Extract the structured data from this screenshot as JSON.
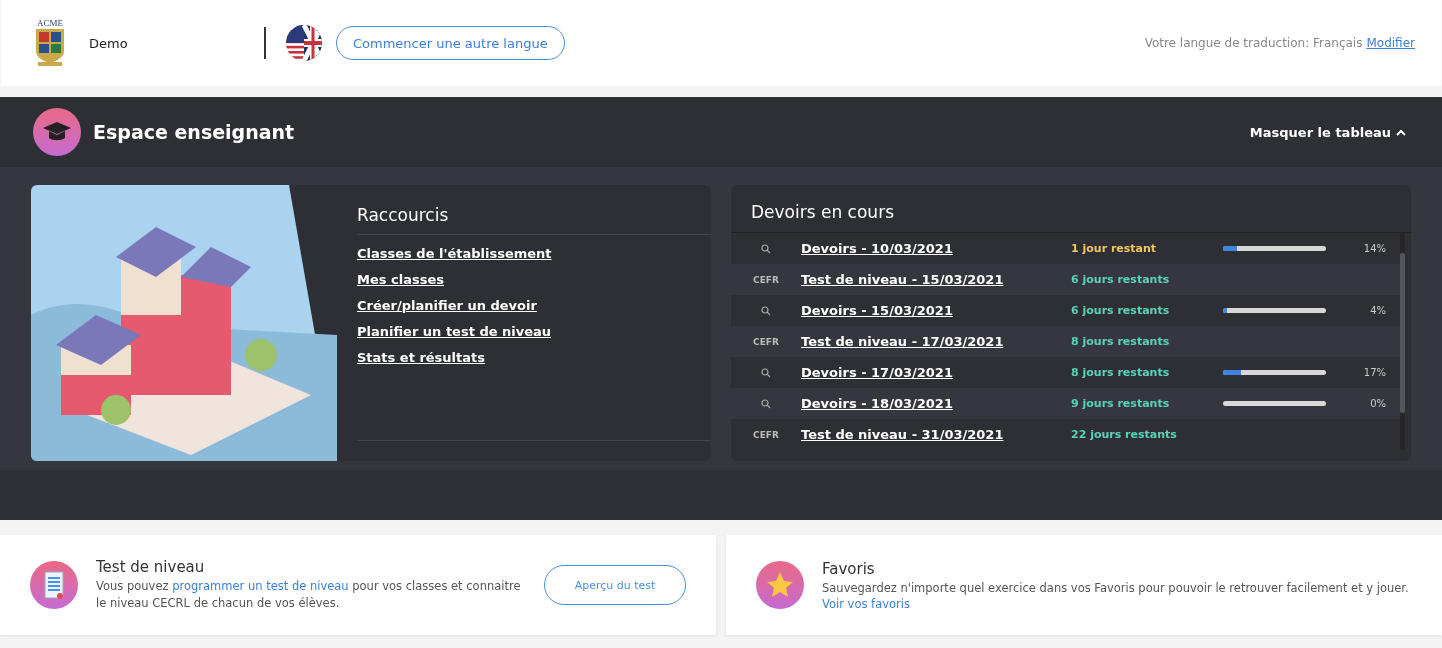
{
  "header": {
    "logo_text": "ACME",
    "user_name": "Demo",
    "language_button": "Commencer une autre langue",
    "translation_label": "Votre langue de traduction: Français",
    "translation_link": "Modifier"
  },
  "teacher_space": {
    "title": "Espace enseignant",
    "toggle": "Masquer le tableau",
    "expanded": true,
    "shortcuts": {
      "title": "Raccourcis",
      "links": [
        "Classes de l'établissement",
        "Mes classes",
        "Créer/planifier un devoir",
        "Planifier un test de niveau",
        "Stats et résultats"
      ]
    },
    "assignments": {
      "title": "Devoirs en cours",
      "rows": [
        {
          "kind": "homework",
          "title": "Devoirs - 10/03/2021",
          "remaining": "1 jour restant",
          "urgent": true,
          "level": 0.14,
          "percent": "14%"
        },
        {
          "kind": "test",
          "tag": "CEFR",
          "title": "Test de niveau - 15/03/2021",
          "remaining": "6 jours restants",
          "urgent": false
        },
        {
          "kind": "homework",
          "title": "Devoirs - 15/03/2021",
          "remaining": "6 jours restants",
          "urgent": false,
          "level": 0.04,
          "percent": "4%"
        },
        {
          "kind": "test",
          "tag": "CEFR",
          "title": "Test de niveau - 17/03/2021",
          "remaining": "8 jours restants",
          "urgent": false
        },
        {
          "kind": "homework",
          "title": "Devoirs - 17/03/2021",
          "remaining": "8 jours restants",
          "urgent": false,
          "level": 0.17,
          "percent": "17%"
        },
        {
          "kind": "homework",
          "title": "Devoirs - 18/03/2021",
          "remaining": "9 jours restants",
          "urgent": false,
          "level": 0,
          "percent": "0%"
        },
        {
          "kind": "test",
          "tag": "CEFR",
          "title": "Test de niveau - 31/03/2021",
          "remaining": "22 jours restants",
          "urgent": false
        }
      ]
    }
  },
  "cards": [
    {
      "kind": "test",
      "title": "Test de niveau",
      "text_before": "Vous pouvez ",
      "link": "programmer un test de niveau",
      "text_after": " pour vos classes et connaitre le niveau CECRL de chacun de vos élèves.",
      "button": "Aperçu du test"
    },
    {
      "kind": "favorites",
      "title": "Favoris",
      "text": "Sauvegardez n'importe quel exercice dans vos Favoris pour pouvoir le retrouver facilement et y jouer.",
      "link": "Voir vos favoris"
    }
  ]
}
